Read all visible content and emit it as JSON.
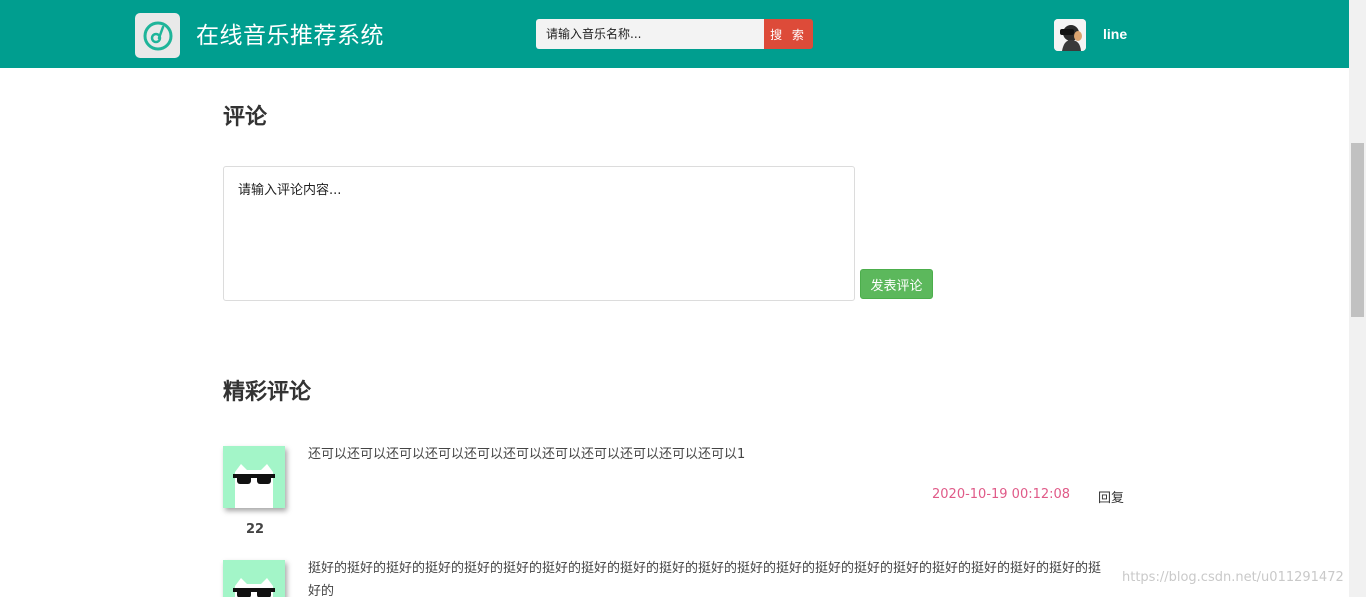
{
  "header": {
    "site_title": "在线音乐推荐系统",
    "search": {
      "placeholder": "请输入音乐名称...",
      "button_label": "搜 索"
    },
    "user": {
      "name": "line"
    },
    "colors": {
      "bar": "#009e8f",
      "search_button": "#dd4b39"
    }
  },
  "comment_form": {
    "title": "评论",
    "placeholder": "请输入评论内容...",
    "submit_label": "发表评论"
  },
  "comments_section": {
    "title": "精彩评论",
    "items": [
      {
        "text": "还可以还可以还可以还可以还可以还可以还可以还可以还可以还可以还可以1",
        "time": "2020-10-19 00:12:08",
        "reply_label": "回复",
        "likes": "22"
      },
      {
        "text": "挺好的挺好的挺好的挺好的挺好的挺好的挺好的挺好的挺好的挺好的挺好的挺好的挺好的挺好的挺好的挺好的挺好的挺好的挺好的挺好的挺好的"
      }
    ]
  },
  "watermark": "https://blog.csdn.net/u011291472"
}
